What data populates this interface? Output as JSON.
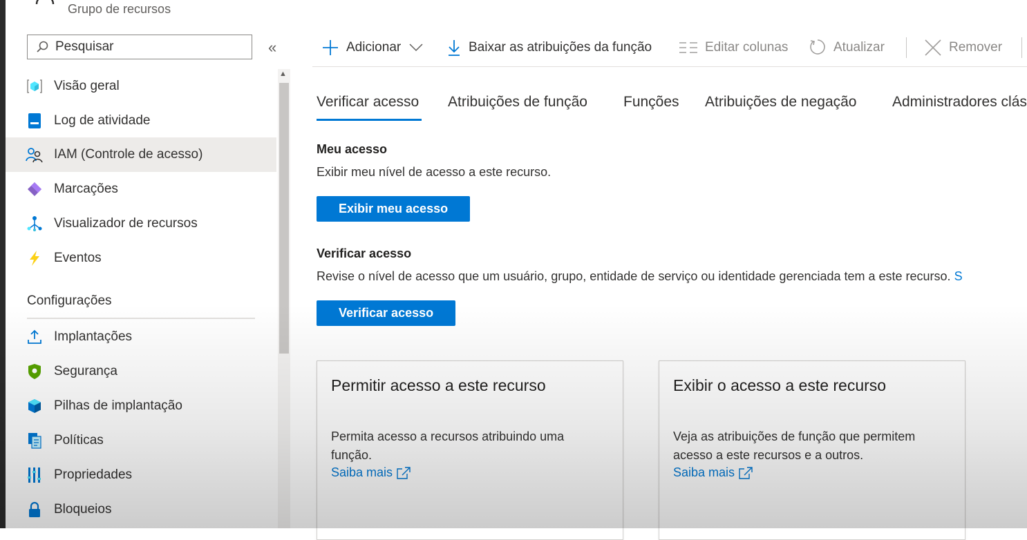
{
  "header": {
    "subtitle": "Grupo de recursos"
  },
  "sidebar": {
    "search_placeholder": "Pesquisar",
    "collapse_glyph": "«",
    "items": [
      {
        "label": "Visão geral",
        "icon": "overview-cube-icon"
      },
      {
        "label": "Log de atividade",
        "icon": "activity-log-icon"
      },
      {
        "label": "IAM (Controle de acesso)",
        "icon": "iam-people-icon",
        "active": true
      },
      {
        "label": "Marcações",
        "icon": "tag-icon"
      },
      {
        "label": "Visualizador de recursos",
        "icon": "resource-visualizer-icon"
      },
      {
        "label": "Eventos",
        "icon": "lightning-icon"
      }
    ],
    "section_title": "Configurações",
    "settings_items": [
      {
        "label": "Implantações",
        "icon": "upload-icon"
      },
      {
        "label": "Segurança",
        "icon": "shield-icon"
      },
      {
        "label": "Pilhas de implantação",
        "icon": "stack-icon"
      },
      {
        "label": "Políticas",
        "icon": "policy-icon"
      },
      {
        "label": "Propriedades",
        "icon": "properties-icon"
      },
      {
        "label": "Bloqueios",
        "icon": "lock-icon"
      }
    ]
  },
  "toolbar": {
    "add": "Adicionar",
    "download": "Baixar as atribuições da função",
    "edit_columns": "Editar colunas",
    "refresh": "Atualizar",
    "remove": "Remover"
  },
  "tabs": [
    "Verificar acesso",
    "Atribuições de função",
    "Funções",
    "Atribuições de negação",
    "Administradores clás"
  ],
  "my_access": {
    "title": "Meu acesso",
    "description": "Exibir meu nível de acesso a este recurso.",
    "button": "Exibir meu acesso"
  },
  "check_access": {
    "title": "Verificar acesso",
    "description": "Revise o nível de acesso que um usuário, grupo, entidade de serviço ou identidade gerenciada tem a este recurso.",
    "link_fragment": "S",
    "button": "Verificar acesso"
  },
  "cards": [
    {
      "title": "Permitir acesso a este recurso",
      "text": "Permita acesso a recursos atribuindo uma função.",
      "link": "Saiba mais"
    },
    {
      "title": "Exibir o acesso a este recurso",
      "text": "Veja as atribuições de função que permitem acesso a este recursos e a outros.",
      "link": "Saiba mais"
    }
  ],
  "colors": {
    "accent": "#0078d4",
    "active_bg": "#edebe9",
    "text": "#323130"
  }
}
